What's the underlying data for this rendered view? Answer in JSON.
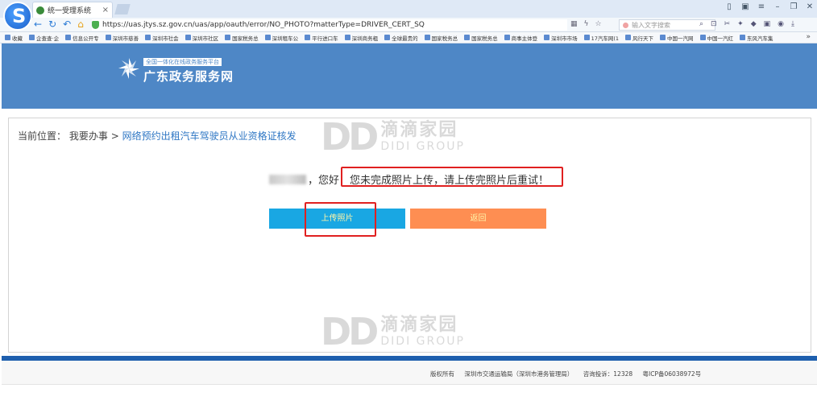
{
  "browser": {
    "logo_letter": "S",
    "tab_title": "统一受理系统",
    "tab_close": "×",
    "url": "https://uas.jtys.sz.gov.cn/uas/app/oauth/error/NO_PHOTO?matterType=DRIVER_CERT_SQ",
    "search_placeholder": "输入文字搜索",
    "bookmarks": [
      "收藏",
      "企查查·企",
      "信息公开专",
      "深圳市慈善",
      "深圳市社会",
      "深圳市社区",
      "国家税务总",
      "深圳租车公",
      "平行进口车",
      "深圳商务粗",
      "全球最贵的",
      "国家税务总",
      "国家税务总",
      "商事主体登",
      "深圳市市场",
      "17汽车网(1",
      "风行天下",
      "中国一汽网",
      "中国一汽红",
      "东风汽车集"
    ],
    "bookmarks_more": "»"
  },
  "header": {
    "tagline": "全国一体化在线政务服务平台",
    "site_name": "广东政务服务网"
  },
  "breadcrumb": {
    "prefix": "当前位置：",
    "level1": "我要办事",
    "separator": ">",
    "current": "网络预约出租汽车驾驶员从业资格证核发"
  },
  "message": {
    "greeting": "，您好！",
    "text": "您未完成照片上传，请上传完照片后重试！"
  },
  "buttons": {
    "upload": "上传照片",
    "back": "返回"
  },
  "watermark": {
    "mark": "DD",
    "cn": "滴滴家园",
    "en": "DIDI GROUP"
  },
  "footer": {
    "copyright": "版权所有",
    "owner": "深圳市交通运输局（深圳市港务管理局）",
    "hotline": "咨询投诉：12328",
    "icp": "粤ICP备06038972号"
  },
  "colors": {
    "header_bg": "#4e87c6",
    "upload_button": "#19a7e3",
    "back_button": "#fe8e52",
    "annotation": "#e02020",
    "footer_bar": "#1e5fae"
  }
}
